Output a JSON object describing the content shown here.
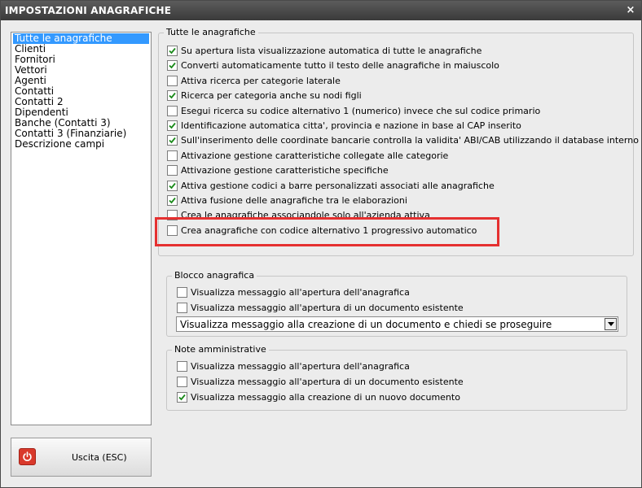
{
  "window": {
    "title": "IMPOSTAZIONI ANAGRAFICHE",
    "close_glyph": "×"
  },
  "left_list": {
    "items": [
      {
        "label": "Tutte le anagrafiche",
        "selected": true
      },
      {
        "label": "Clienti"
      },
      {
        "label": "Fornitori"
      },
      {
        "label": "Vettori"
      },
      {
        "label": "Agenti"
      },
      {
        "label": "Contatti"
      },
      {
        "label": "Contatti 2"
      },
      {
        "label": "Dipendenti"
      },
      {
        "label": "Banche (Contatti 3)"
      },
      {
        "label": "Contatti 3 (Finanziarie)"
      },
      {
        "label": "Descrizione campi"
      }
    ]
  },
  "exit_button": {
    "label": "Uscita (ESC)",
    "icon": "power-icon",
    "icon_color": "#d9392b"
  },
  "main_group": {
    "legend": "Tutte le anagrafiche",
    "options": [
      {
        "label": "Su apertura lista visualizzazione automatica di tutte le anagrafiche",
        "checked": true
      },
      {
        "label": "Converti automaticamente tutto il testo delle anagrafiche in maiuscolo",
        "checked": true
      },
      {
        "label": "Attiva ricerca per categorie laterale",
        "checked": false
      },
      {
        "label": "Ricerca per categoria anche su nodi figli",
        "checked": true
      },
      {
        "label": "Esegui ricerca su codice alternativo 1 (numerico) invece che sul codice primario",
        "checked": false
      },
      {
        "label": "Identificazione automatica citta', provincia e nazione in base al CAP inserito",
        "checked": true
      },
      {
        "label": "Sull'inserimento delle coordinate bancarie controlla la validita' ABI/CAB utilizzando il database interno",
        "checked": true
      },
      {
        "label": "Attivazione gestione caratteristiche collegate alle categorie",
        "checked": false
      },
      {
        "label": "Attivazione gestione caratteristiche specifiche",
        "checked": false
      },
      {
        "label": "Attiva gestione codici a barre personalizzati associati alle anagrafiche",
        "checked": true
      },
      {
        "label": "Attiva fusione delle anagrafiche tra le elaborazioni",
        "checked": true
      },
      {
        "label": "Crea le anagrafiche associandole solo all'azienda attiva",
        "checked": false
      },
      {
        "label": "Crea anagrafiche con codice alternativo 1 progressivo automatico",
        "checked": false
      }
    ]
  },
  "blocco_group": {
    "legend": "Blocco anagrafica",
    "options": [
      {
        "label": "Visualizza messaggio all'apertura dell'anagrafica",
        "checked": false
      },
      {
        "label": "Visualizza messaggio all'apertura di un documento esistente",
        "checked": false
      }
    ],
    "dropdown_value": "Visualizza messaggio alla creazione di un documento e chiedi se proseguire"
  },
  "note_group": {
    "legend": "Note amministrative",
    "options": [
      {
        "label": "Visualizza messaggio all'apertura dell'anagrafica",
        "checked": false
      },
      {
        "label": "Visualizza messaggio all'apertura di un documento esistente",
        "checked": false
      },
      {
        "label": "Visualizza messaggio alla creazione di un nuovo documento",
        "checked": true
      }
    ]
  },
  "colors": {
    "selection": "#3399ff",
    "highlight": "#e53030",
    "check": "#1a8a1a"
  }
}
